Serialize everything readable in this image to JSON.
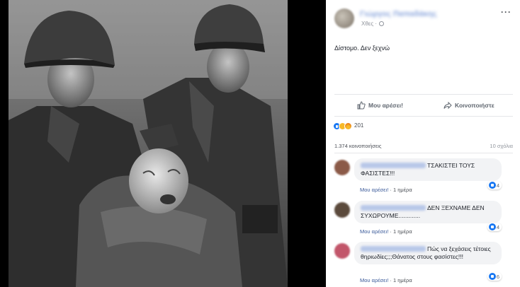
{
  "post": {
    "author_name": "Γιώργος Παπαδάκης",
    "timestamp": "Χθες ·",
    "text": "Δίστομο. Δεν ξεχνώ",
    "more_label": "···"
  },
  "photo": {
    "description": "Black-and-white archival photograph of two soldiers in helmets holding a crying infant",
    "colors": {
      "background": "#000000"
    }
  },
  "actions": {
    "like_label": "Μου αρέσει!",
    "share_label": "Κοινοποιήστε"
  },
  "reactions": {
    "icons": [
      "like-icon",
      "sad-icon",
      "angry-icon"
    ],
    "count": "201"
  },
  "stats": {
    "shares": "1.374 κοινοποιήσεις",
    "comments": "10 σχόλια"
  },
  "comments": [
    {
      "text": "ΤΣΑΚΙΣΤΕΙ ΤΟΥΣ ΦΑΣΙΣΤΕΣ!!!",
      "like_label": "Μου αρέσει!",
      "time": "· 1 ημέρα",
      "likes": "4",
      "avatar_color": "#8b5a48"
    },
    {
      "text": "ΔΕΝ ΞΕΧΝΑΜΕ ΔΕΝ ΣΥΧΩΡΟΥΜΕ.............",
      "like_label": "Μου αρέσει!",
      "time": "· 1 ημέρα",
      "likes": "4",
      "avatar_color": "#5b4a3c"
    },
    {
      "text": "Πώς να ξεχάσεις τέτοιες θηριωδίες;;;Θάνατος στους φασίστες!!!",
      "like_label": "Μου αρέσει!",
      "time": "· 1 ημέρα",
      "likes": "6",
      "avatar_color": "#c2566a"
    }
  ],
  "colors": {
    "facebook_blue": "#1877f2",
    "link_blue": "#385898",
    "bubble_bg": "#f2f3f5",
    "text": "#1d2129"
  }
}
